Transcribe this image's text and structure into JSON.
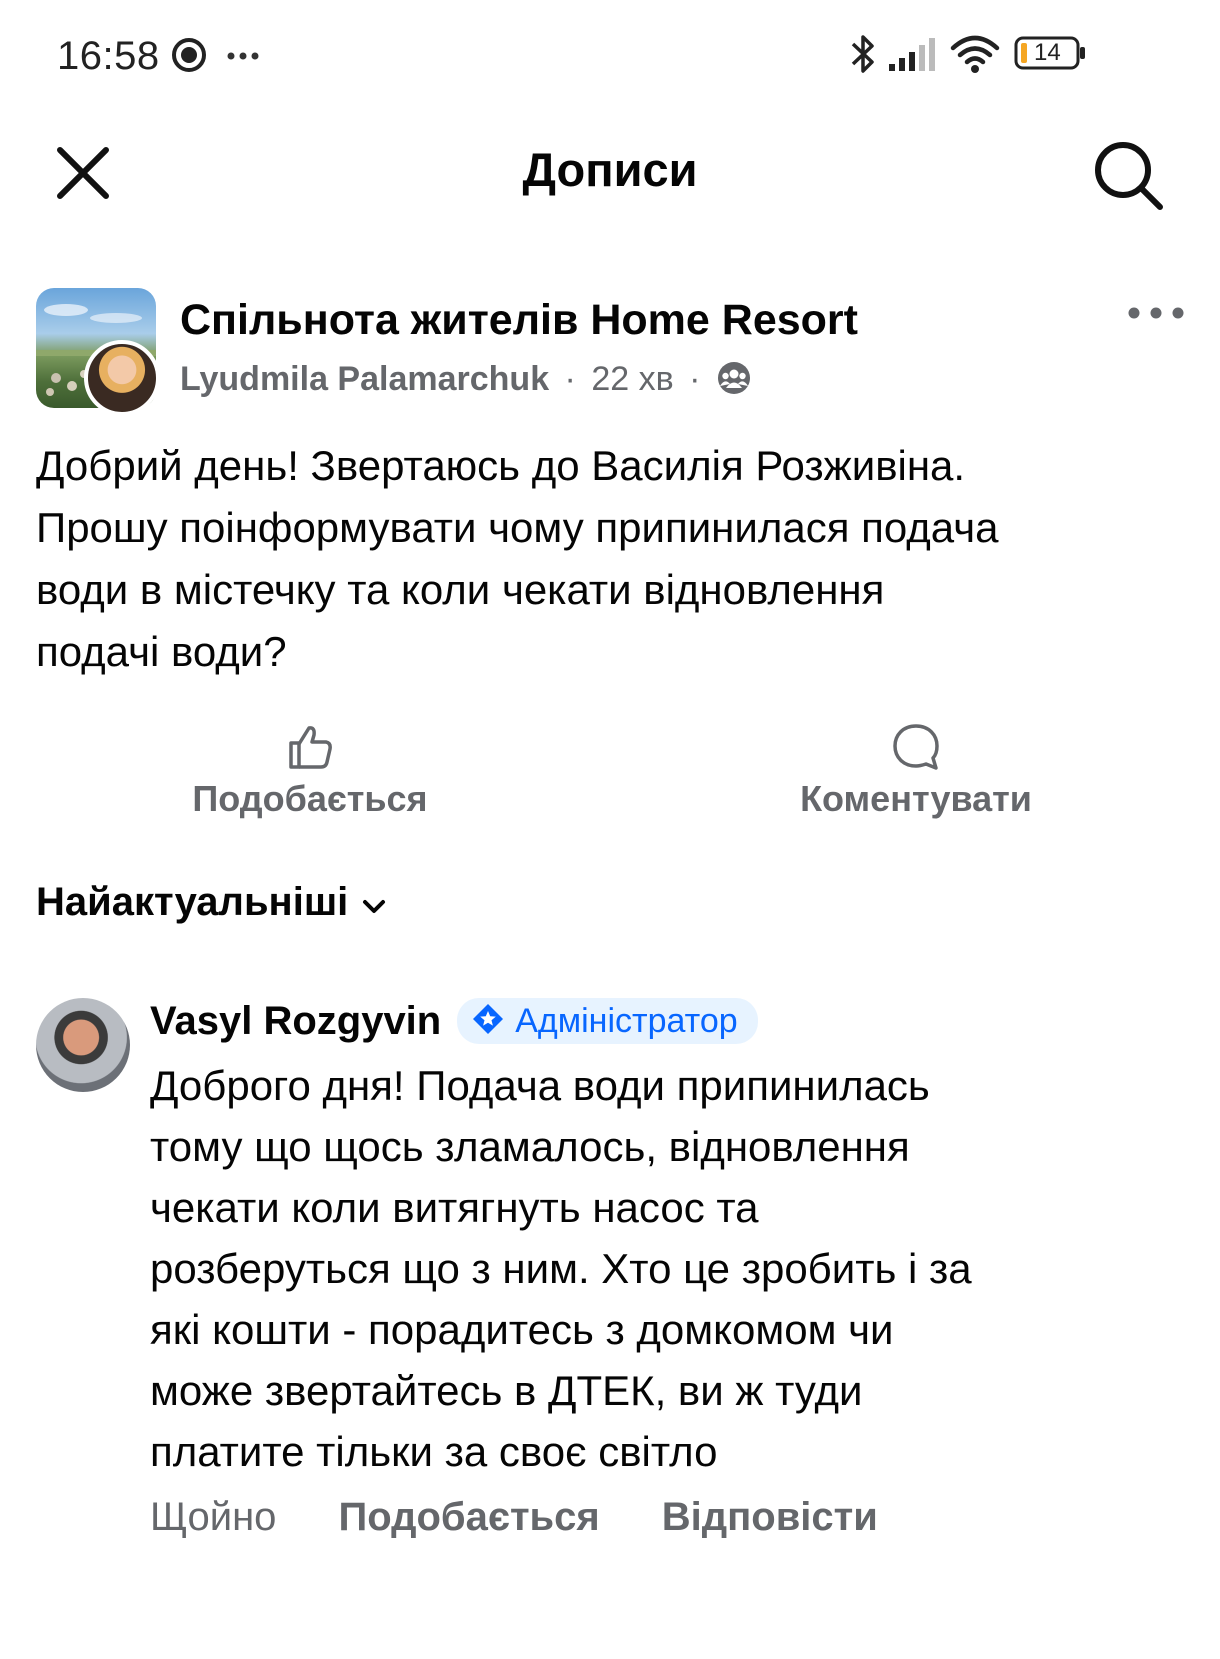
{
  "status_bar": {
    "time": "16:58",
    "battery": "14",
    "icons": [
      "messenger-icon",
      "more-dots-icon",
      "bluetooth-icon",
      "signal-icon",
      "wifi-icon",
      "battery-icon"
    ]
  },
  "header": {
    "title": "Дописи",
    "close_icon": "close-icon",
    "search_icon": "search-icon"
  },
  "post": {
    "group_name": "Спільнота жителів Home Resort",
    "author": "Lyudmila  Palamarchuk",
    "time": "22 хв",
    "privacy_icon": "group-members-icon",
    "text_lines": [
      "Добрий день! Звертаюсь до Василія Розживіна.",
      "Прошу поінформувати чому припинилася подача",
      "води в містечку та коли чекати відновлення",
      "подачі води?"
    ],
    "actions": {
      "like": "Подобається",
      "comment": "Коментувати"
    }
  },
  "sort": {
    "label": "Найактуальніші"
  },
  "comment": {
    "author": "Vasyl Rozgyvin",
    "badge": "Адміністратор",
    "text_lines": [
      "Доброго дня! Подача води припинилась",
      "тому що щось зламалось, відновлення",
      "чекати коли витягнуть насос та",
      "розберуться що з ним. Хто це зробить і за",
      "які кошти - порадитесь з домкомом чи",
      "може звертайтесь в ДТЕК, ви ж туди",
      "платите тільки за своє світло"
    ],
    "time": "Щойно",
    "like": "Подобається",
    "reply": "Відповісти"
  },
  "colors": {
    "text": "#050505",
    "secondary": "#65676b",
    "accent_blue": "#0866ff",
    "badge_bg": "#e7f3ff",
    "battery_low": "#f5a623"
  }
}
